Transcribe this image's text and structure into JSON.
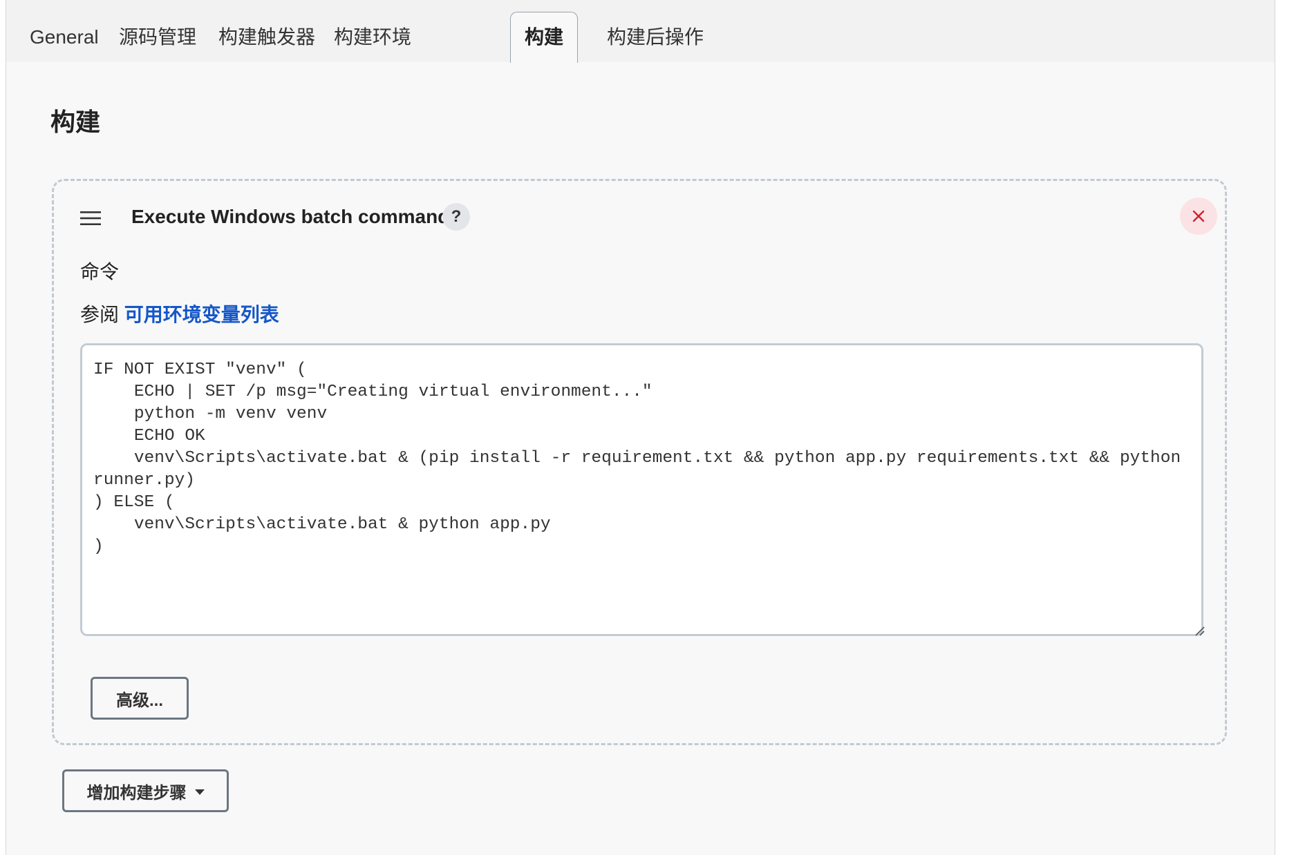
{
  "tabs": [
    {
      "label": "General"
    },
    {
      "label": "源码管理"
    },
    {
      "label": "构建触发器"
    },
    {
      "label": "构建环境"
    },
    {
      "label": "构建",
      "active": true
    },
    {
      "label": "构建后操作"
    }
  ],
  "section": {
    "title": "构建"
  },
  "build_step": {
    "title": "Execute Windows batch command",
    "help_label": "?",
    "drag_icon": "hamburger-icon",
    "delete_icon": "close-icon",
    "command_label": "命令",
    "env_prefix": "参阅",
    "env_link": "可用环境变量列表",
    "command_value": "IF NOT EXIST \"venv\" (\n    ECHO | SET /p msg=\"Creating virtual environment...\"\n    python -m venv venv\n    ECHO OK\n    venv\\Scripts\\activate.bat & (pip install -r requirement.txt && python app.py requirements.txt && python runner.py)\n) ELSE (\n    venv\\Scripts\\activate.bat & python app.py\n)",
    "advanced_label": "高级..."
  },
  "add_step": {
    "label": "增加构建步骤",
    "icon": "caret-down-icon"
  },
  "colors": {
    "accent_link": "#1457c9",
    "delete_bg": "#fbe3e5",
    "delete_fg": "#d0202e",
    "card_border": "#c1c9d2"
  }
}
